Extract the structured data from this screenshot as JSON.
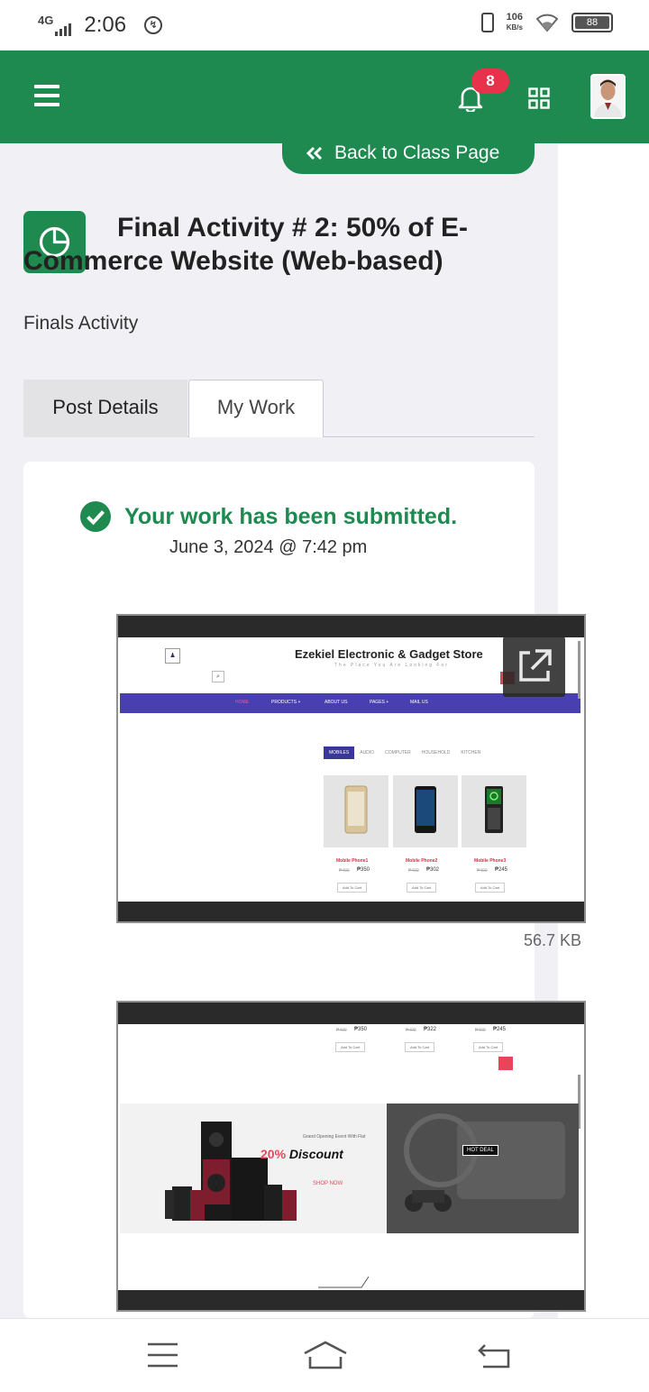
{
  "status_bar": {
    "network": "4G",
    "time": "2:06",
    "speed_value": "106",
    "speed_unit": "KB/s",
    "battery": "88"
  },
  "header": {
    "notification_count": "8",
    "icons": [
      "menu-icon",
      "bell-icon",
      "apps-grid-icon",
      "profile-avatar"
    ]
  },
  "back_button": {
    "label": "Back to Class Page"
  },
  "activity": {
    "title": "Final Activity # 2: 50% of E-Commerce Website (Web-based)",
    "subtitle": "Finals Activity"
  },
  "tabs": [
    {
      "label": "Post Details",
      "active": false
    },
    {
      "label": "My Work",
      "active": true
    }
  ],
  "submission": {
    "status": "Your work has been submitted.",
    "date": "June 3, 2024 @ 7:42 pm"
  },
  "attachments": [
    {
      "file_size": "56.7 KB",
      "preview": {
        "store_title": "Ezekiel Electronic & Gadget Store",
        "store_tagline": "The Place You Are Looking For",
        "nav": [
          "HOME",
          "PRODUCTS +",
          "ABOUT US",
          "PAGES +",
          "MAIL US"
        ],
        "categories": [
          "MOBILES",
          "AUDIO",
          "COMPUTER",
          "HOUSEHOLD",
          "KITCHEN"
        ],
        "products": [
          {
            "name": "Mobile Phone1",
            "old_price": "₱400",
            "price": "₱350",
            "button": "Add To Cart"
          },
          {
            "name": "Mobile Phone2",
            "old_price": "₱400",
            "price": "₱302",
            "button": "Add To Cart"
          },
          {
            "name": "Mobile Phone3",
            "old_price": "₱400",
            "price": "₱245",
            "button": "Add To Cart"
          }
        ]
      }
    },
    {
      "preview": {
        "prices": [
          "₱350",
          "₱322",
          "₱245"
        ],
        "old_price": "₱400",
        "button": "Add To Cart",
        "promo_kicker": "Grand Opening Event With Flat",
        "promo_percent": "20%",
        "promo_text": "Discount",
        "promo_cta": "SHOP NOW",
        "hot_deal": "HOT DEAL"
      }
    }
  ],
  "colors": {
    "brand_green": "#1e8a50",
    "badge_red": "#e8324b",
    "preview_nav_purple": "#4a3fb0"
  }
}
